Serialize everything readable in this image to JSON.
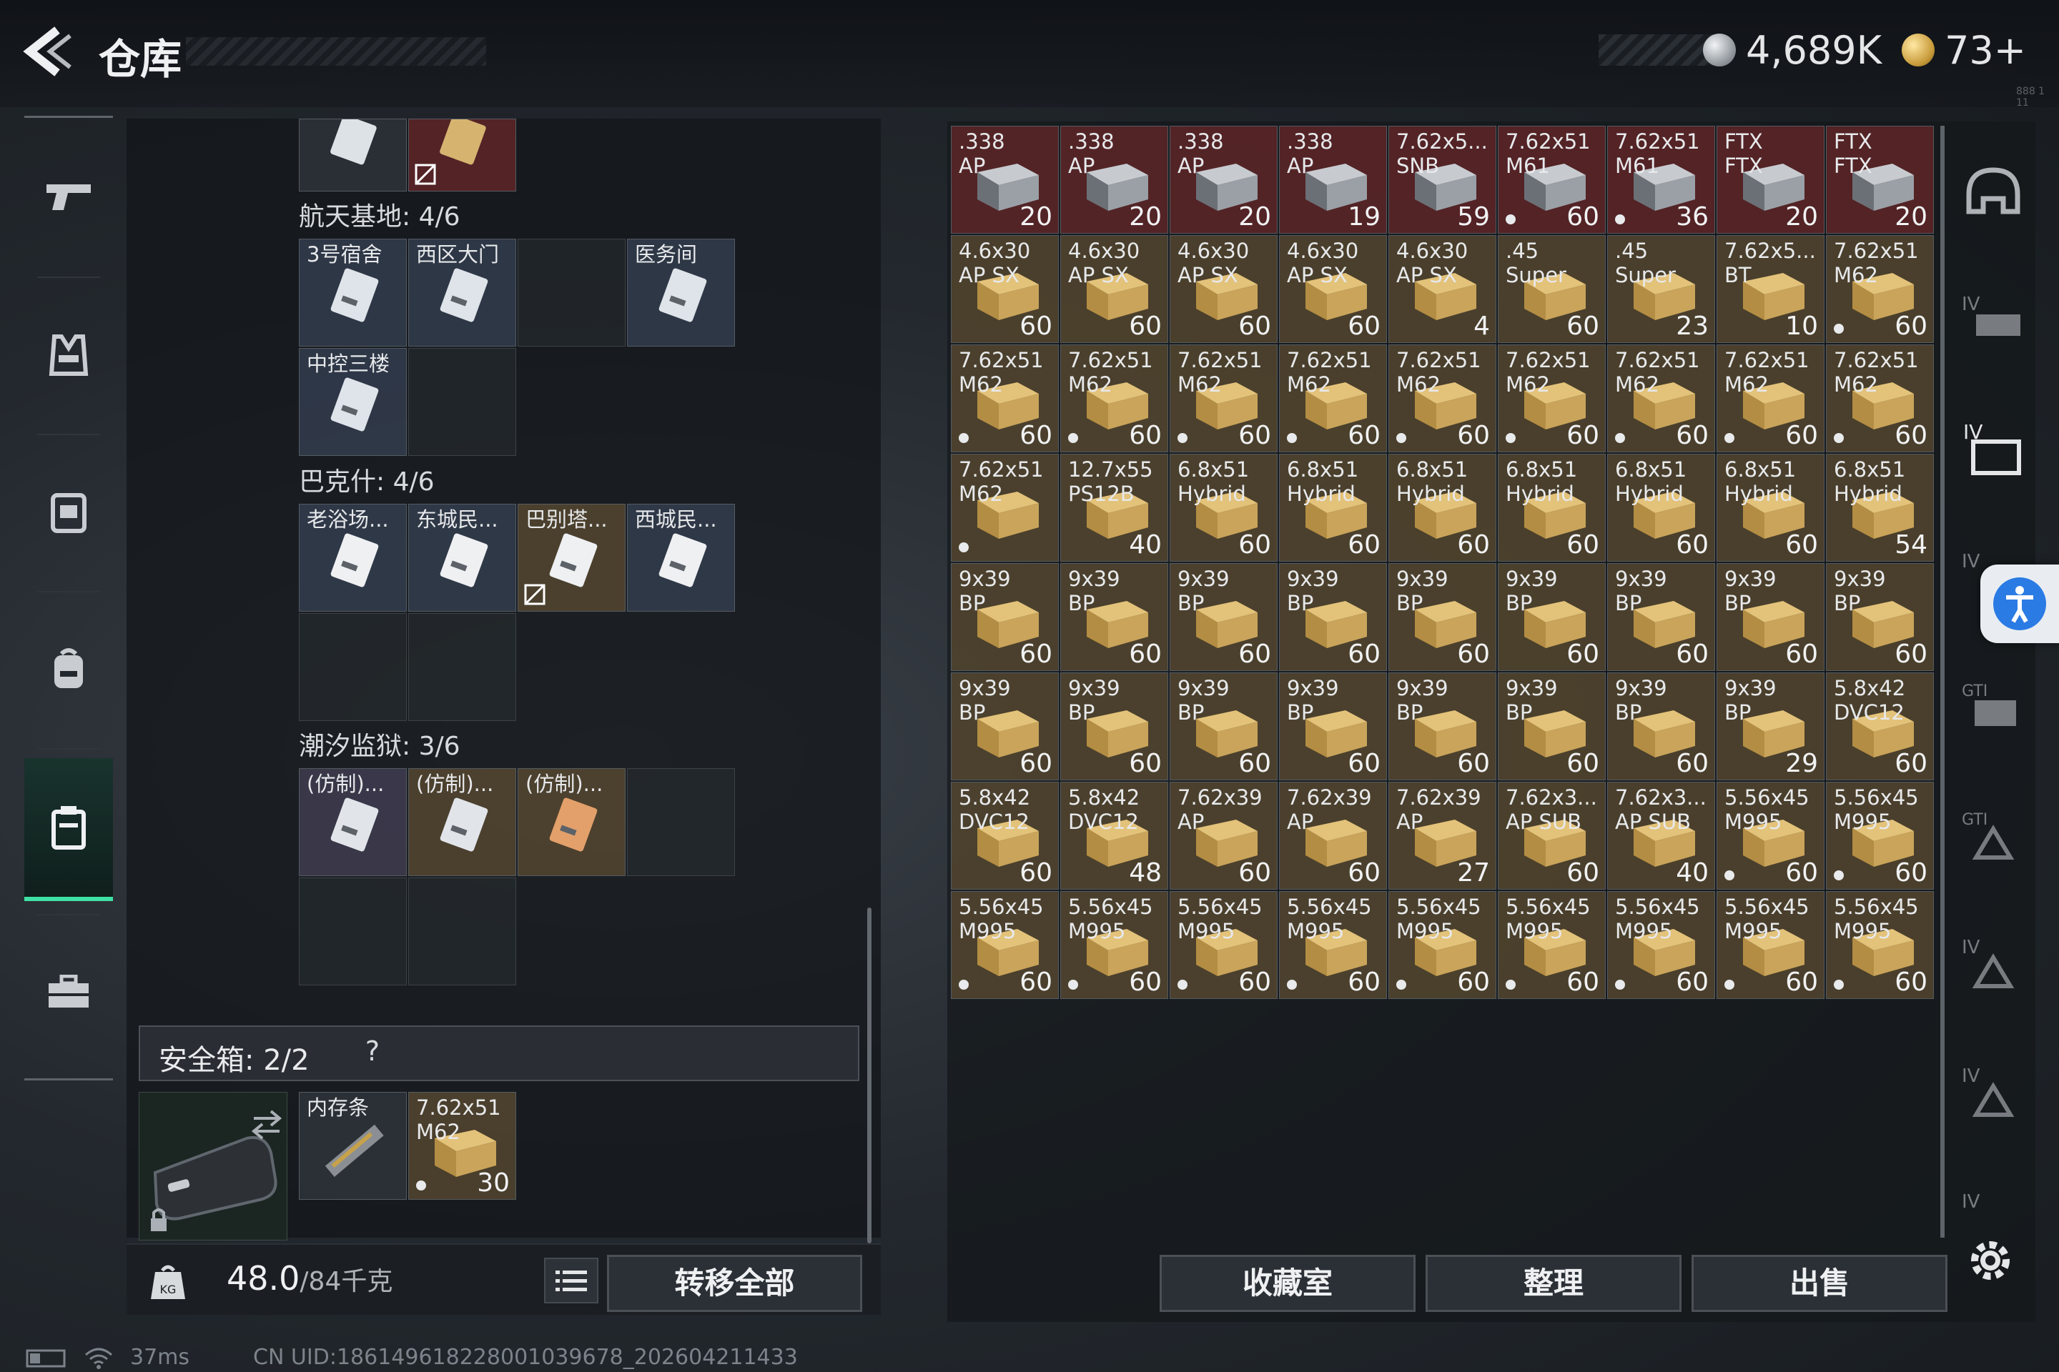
{
  "header": {
    "title": "仓库",
    "currencies": [
      {
        "name": "coin-silver",
        "value": "4,689K"
      },
      {
        "name": "coin-gold",
        "value": "73+"
      }
    ],
    "corner_label": "888 1 11"
  },
  "nav": {
    "items": [
      {
        "name": "nav-weapons",
        "icon": "pistol-icon"
      },
      {
        "name": "nav-armor",
        "icon": "vest-icon"
      },
      {
        "name": "nav-rig",
        "icon": "chest-rig-icon"
      },
      {
        "name": "nav-backpack",
        "icon": "backpack-icon"
      },
      {
        "name": "nav-keys",
        "icon": "keycard-case-icon",
        "active": true
      },
      {
        "name": "nav-case",
        "icon": "briefcase-icon"
      }
    ]
  },
  "key_sections": [
    {
      "title": "航天基地: 4/6",
      "cards": [
        "3号宿舍",
        "西区大门",
        "",
        "医务间",
        "中控三楼",
        ""
      ]
    },
    {
      "title": "巴克什: 4/6",
      "cards": [
        "老浴场...",
        "东城民...",
        "巴别塔...",
        "西城民...",
        "",
        ""
      ]
    },
    {
      "title": "潮汐监狱: 3/6",
      "cards": [
        "(仿制)...",
        "(仿制)...",
        "(仿制)...",
        "",
        "",
        ""
      ]
    }
  ],
  "safebox": {
    "title": "安全箱: 2/2",
    "help": "?",
    "items": [
      {
        "label": "内存条",
        "count": ""
      },
      {
        "label": "7.62x51\nM62",
        "count": "30"
      }
    ]
  },
  "bottom": {
    "weight_value": "48.0",
    "weight_capacity": "/84千克",
    "transfer_all": "转移全部"
  },
  "stash": {
    "items": [
      {
        "l": ".338\nAP",
        "c": "20",
        "t": "red"
      },
      {
        "l": ".338\nAP",
        "c": "20",
        "t": "red"
      },
      {
        "l": ".338\nAP",
        "c": "20",
        "t": "red"
      },
      {
        "l": ".338\nAP",
        "c": "19",
        "t": "red"
      },
      {
        "l": "7.62x5...\nSNB",
        "c": "59",
        "t": "red"
      },
      {
        "l": "7.62x51\nM61",
        "c": "60",
        "t": "red",
        "dot": true
      },
      {
        "l": "7.62x51\nM61",
        "c": "36",
        "t": "red",
        "dot": true
      },
      {
        "l": "FTX\nFTX",
        "c": "20",
        "t": "red"
      },
      {
        "l": "FTX\nFTX",
        "c": "20",
        "t": "red"
      },
      {
        "l": "4.6x30\nAP SX",
        "c": "60",
        "t": "gold"
      },
      {
        "l": "4.6x30\nAP SX",
        "c": "60",
        "t": "gold"
      },
      {
        "l": "4.6x30\nAP SX",
        "c": "60",
        "t": "gold"
      },
      {
        "l": "4.6x30\nAP SX",
        "c": "60",
        "t": "gold"
      },
      {
        "l": "4.6x30\nAP SX",
        "c": "4",
        "t": "gold"
      },
      {
        "l": ".45\nSuper",
        "c": "60",
        "t": "gold"
      },
      {
        "l": ".45\nSuper",
        "c": "23",
        "t": "gold"
      },
      {
        "l": "7.62x5...\nBT",
        "c": "10",
        "t": "gold"
      },
      {
        "l": "7.62x51\nM62",
        "c": "60",
        "t": "gold",
        "dot": true
      },
      {
        "l": "7.62x51\nM62",
        "c": "60",
        "t": "gold",
        "dot": true
      },
      {
        "l": "7.62x51\nM62",
        "c": "60",
        "t": "gold",
        "dot": true
      },
      {
        "l": "7.62x51\nM62",
        "c": "60",
        "t": "gold",
        "dot": true
      },
      {
        "l": "7.62x51\nM62",
        "c": "60",
        "t": "gold",
        "dot": true
      },
      {
        "l": "7.62x51\nM62",
        "c": "60",
        "t": "gold",
        "dot": true
      },
      {
        "l": "7.62x51\nM62",
        "c": "60",
        "t": "gold",
        "dot": true
      },
      {
        "l": "7.62x51\nM62",
        "c": "60",
        "t": "gold",
        "dot": true
      },
      {
        "l": "7.62x51\nM62",
        "c": "60",
        "t": "gold",
        "dot": true
      },
      {
        "l": "7.62x51\nM62",
        "c": "60",
        "t": "gold",
        "dot": true
      },
      {
        "l": "7.62x51\nM62",
        "c": "",
        "t": "gold",
        "dot": true
      },
      {
        "l": "12.7x55\nPS12B",
        "c": "40",
        "t": "gold"
      },
      {
        "l": "6.8x51\nHybrid",
        "c": "60",
        "t": "gold"
      },
      {
        "l": "6.8x51\nHybrid",
        "c": "60",
        "t": "gold"
      },
      {
        "l": "6.8x51\nHybrid",
        "c": "60",
        "t": "gold"
      },
      {
        "l": "6.8x51\nHybrid",
        "c": "60",
        "t": "gold"
      },
      {
        "l": "6.8x51\nHybrid",
        "c": "60",
        "t": "gold"
      },
      {
        "l": "6.8x51\nHybrid",
        "c": "60",
        "t": "gold"
      },
      {
        "l": "6.8x51\nHybrid",
        "c": "54",
        "t": "gold"
      },
      {
        "l": "9x39\nBP",
        "c": "60",
        "t": "gold"
      },
      {
        "l": "9x39\nBP",
        "c": "60",
        "t": "gold"
      },
      {
        "l": "9x39\nBP",
        "c": "60",
        "t": "gold"
      },
      {
        "l": "9x39\nBP",
        "c": "60",
        "t": "gold"
      },
      {
        "l": "9x39\nBP",
        "c": "60",
        "t": "gold"
      },
      {
        "l": "9x39\nBP",
        "c": "60",
        "t": "gold"
      },
      {
        "l": "9x39\nBP",
        "c": "60",
        "t": "gold"
      },
      {
        "l": "9x39\nBP",
        "c": "60",
        "t": "gold"
      },
      {
        "l": "9x39\nBP",
        "c": "60",
        "t": "gold"
      },
      {
        "l": "9x39\nBP",
        "c": "60",
        "t": "gold"
      },
      {
        "l": "9x39\nBP",
        "c": "60",
        "t": "gold"
      },
      {
        "l": "9x39\nBP",
        "c": "60",
        "t": "gold"
      },
      {
        "l": "9x39\nBP",
        "c": "60",
        "t": "gold"
      },
      {
        "l": "9x39\nBP",
        "c": "60",
        "t": "gold"
      },
      {
        "l": "9x39\nBP",
        "c": "60",
        "t": "gold"
      },
      {
        "l": "9x39\nBP",
        "c": "60",
        "t": "gold"
      },
      {
        "l": "9x39\nBP",
        "c": "29",
        "t": "gold"
      },
      {
        "l": "5.8x42\nDVC12",
        "c": "60",
        "t": "gold"
      },
      {
        "l": "5.8x42\nDVC12",
        "c": "60",
        "t": "gold"
      },
      {
        "l": "5.8x42\nDVC12",
        "c": "48",
        "t": "gold"
      },
      {
        "l": "7.62x39\nAP",
        "c": "60",
        "t": "gold"
      },
      {
        "l": "7.62x39\nAP",
        "c": "60",
        "t": "gold"
      },
      {
        "l": "7.62x39\nAP",
        "c": "27",
        "t": "gold"
      },
      {
        "l": "7.62x3...\nAP SUB",
        "c": "60",
        "t": "gold"
      },
      {
        "l": "7.62x3...\nAP SUB",
        "c": "40",
        "t": "gold"
      },
      {
        "l": "5.56x45\nM995",
        "c": "60",
        "t": "gold",
        "dot": true
      },
      {
        "l": "5.56x45\nM995",
        "c": "60",
        "t": "gold",
        "dot": true
      },
      {
        "l": "5.56x45\nM995",
        "c": "60",
        "t": "gold",
        "dot": true
      },
      {
        "l": "5.56x45\nM995",
        "c": "60",
        "t": "gold",
        "dot": true
      },
      {
        "l": "5.56x45\nM995",
        "c": "60",
        "t": "gold",
        "dot": true
      },
      {
        "l": "5.56x45\nM995",
        "c": "60",
        "t": "gold",
        "dot": true
      },
      {
        "l": "5.56x45\nM995",
        "c": "60",
        "t": "gold",
        "dot": true
      },
      {
        "l": "5.56x45\nM995",
        "c": "60",
        "t": "gold",
        "dot": true
      },
      {
        "l": "5.56x45\nM995",
        "c": "60",
        "t": "gold",
        "dot": true
      },
      {
        "l": "5.56x45\nM995",
        "c": "60",
        "t": "gold",
        "dot": true
      },
      {
        "l": "5.56x45\nM995",
        "c": "60",
        "t": "gold",
        "dot": true
      }
    ]
  },
  "actions": {
    "collection_room": "收藏室",
    "sort": "整理",
    "sell": "出售"
  },
  "right_rail": [
    "helmet-icon",
    "armor-iv-icon",
    "armor-iv-active-icon",
    "armor-iv-icon",
    "gti-rig-icon",
    "gti-rig-icon",
    "rig-iv-icon",
    "rig-iv-icon",
    "rig-iv-icon"
  ],
  "status": {
    "ping": "37ms",
    "uid": "CN UID:18614961822800103967​8_202604211433"
  },
  "colors": {
    "accent_green": "#3fe0a5",
    "cell_red": "#6e282a",
    "cell_gold": "#5c4c32",
    "accessibility_blue": "#2b7be4"
  }
}
